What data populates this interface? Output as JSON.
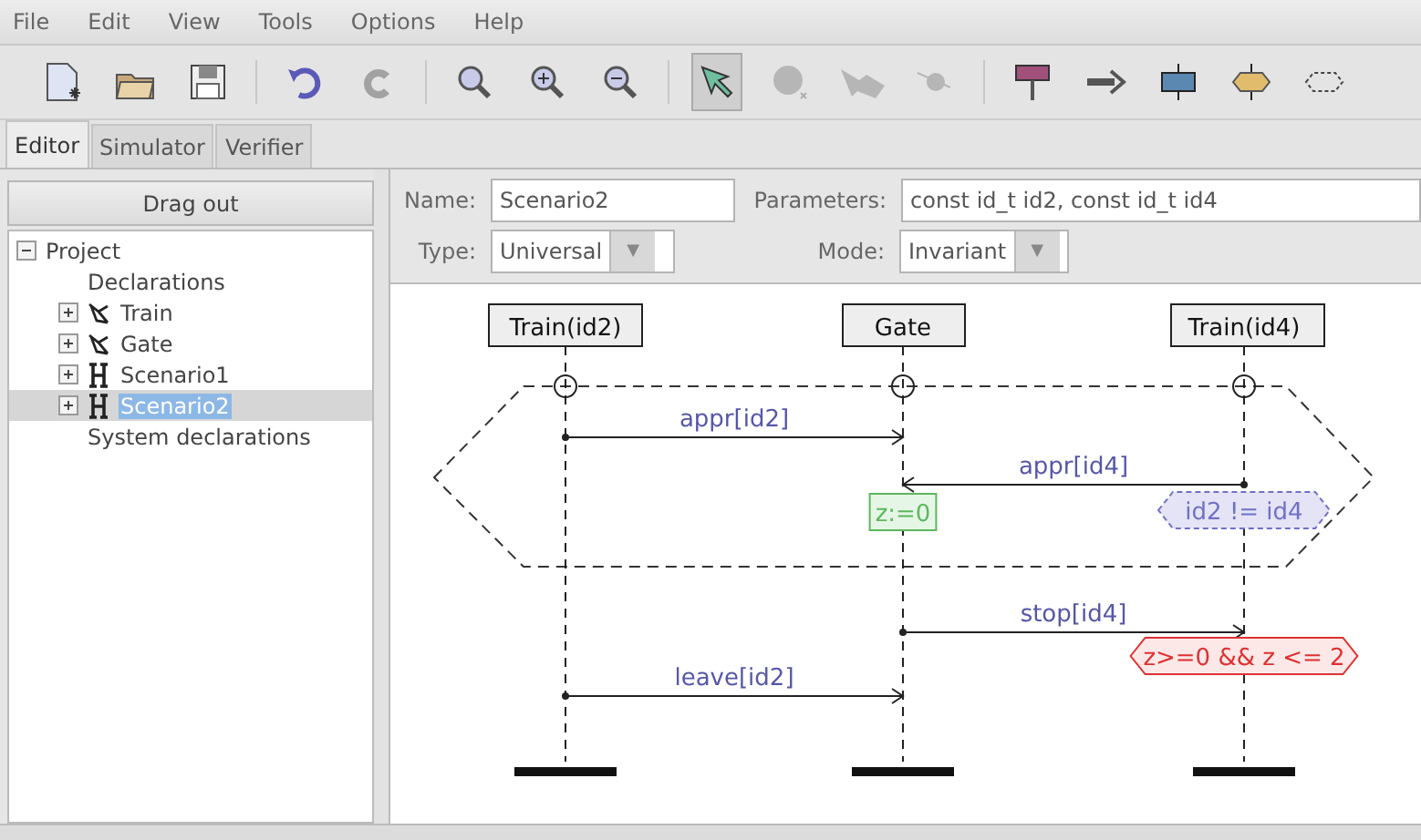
{
  "menu": [
    {
      "label": "File"
    },
    {
      "label": "Edit"
    },
    {
      "label": "View"
    },
    {
      "label": "Tools"
    },
    {
      "label": "Options"
    },
    {
      "label": "Help"
    }
  ],
  "toolbar": [
    [
      {
        "kind": "new",
        "disabled": false,
        "selected": false
      },
      {
        "kind": "open",
        "disabled": false,
        "selected": false
      },
      {
        "kind": "save",
        "disabled": false,
        "selected": false
      }
    ],
    [
      {
        "kind": "undo",
        "disabled": false,
        "selected": false
      },
      {
        "kind": "redo",
        "disabled": true,
        "selected": false
      }
    ],
    [
      {
        "kind": "zoom",
        "disabled": false,
        "selected": false
      },
      {
        "kind": "zoom-in",
        "disabled": false,
        "selected": false
      },
      {
        "kind": "zoom-out",
        "disabled": false,
        "selected": false
      }
    ],
    [
      {
        "kind": "select",
        "disabled": false,
        "selected": true
      },
      {
        "kind": "location",
        "disabled": true,
        "selected": false
      },
      {
        "kind": "edge",
        "disabled": true,
        "selected": false
      },
      {
        "kind": "nail",
        "disabled": true,
        "selected": false
      }
    ],
    [
      {
        "kind": "instance",
        "disabled": false,
        "selected": false
      },
      {
        "kind": "message",
        "disabled": false,
        "selected": false
      },
      {
        "kind": "update",
        "disabled": false,
        "selected": false
      },
      {
        "kind": "condition",
        "disabled": false,
        "selected": false
      },
      {
        "kind": "prechart",
        "disabled": false,
        "selected": false
      }
    ]
  ],
  "tabs": [
    {
      "label": "Editor",
      "selected": true
    },
    {
      "label": "Simulator",
      "selected": false
    },
    {
      "label": "Verifier",
      "selected": false
    }
  ],
  "drag_button": "Drag out",
  "tree": [
    {
      "label": "Project",
      "expanded": true,
      "selected": false,
      "children": [
        {
          "label": "Declarations",
          "selected": false
        },
        {
          "label": "Train",
          "kind": "template",
          "expanded": false,
          "selected": false
        },
        {
          "label": "Gate",
          "kind": "template",
          "expanded": false,
          "selected": false
        },
        {
          "label": "Scenario1",
          "kind": "scenario",
          "expanded": false,
          "selected": false
        },
        {
          "label": "Scenario2",
          "kind": "scenario",
          "expanded": false,
          "selected": true
        },
        {
          "label": "System declarations",
          "selected": false
        }
      ]
    }
  ],
  "form": {
    "name_label": "Name:",
    "name": "Scenario2",
    "parameters_label": "Parameters:",
    "parameters": "const id_t id2, const id_t id4",
    "type_label": "Type:",
    "type": "Universal",
    "mode_label": "Mode:",
    "mode": "Invariant",
    "dropdown_arrow": "▼"
  },
  "diagram": {
    "instances": [
      {
        "label": "Train(id2)"
      },
      {
        "label": "Gate"
      },
      {
        "label": "Train(id4)"
      }
    ],
    "messages": [
      {
        "label": "appr[id2]",
        "kind": "right"
      },
      {
        "label": "appr[id4]",
        "kind": "left"
      },
      {
        "label": "stop[id4]",
        "kind": "right"
      },
      {
        "label": "leave[id2]",
        "kind": "right"
      }
    ],
    "annotations": [
      {
        "text": "z:=0",
        "kind": "update"
      },
      {
        "text": "id2 != id4",
        "kind": "condition"
      },
      {
        "text": "z>=0 && z <= 2",
        "kind": "invariant"
      }
    ]
  }
}
